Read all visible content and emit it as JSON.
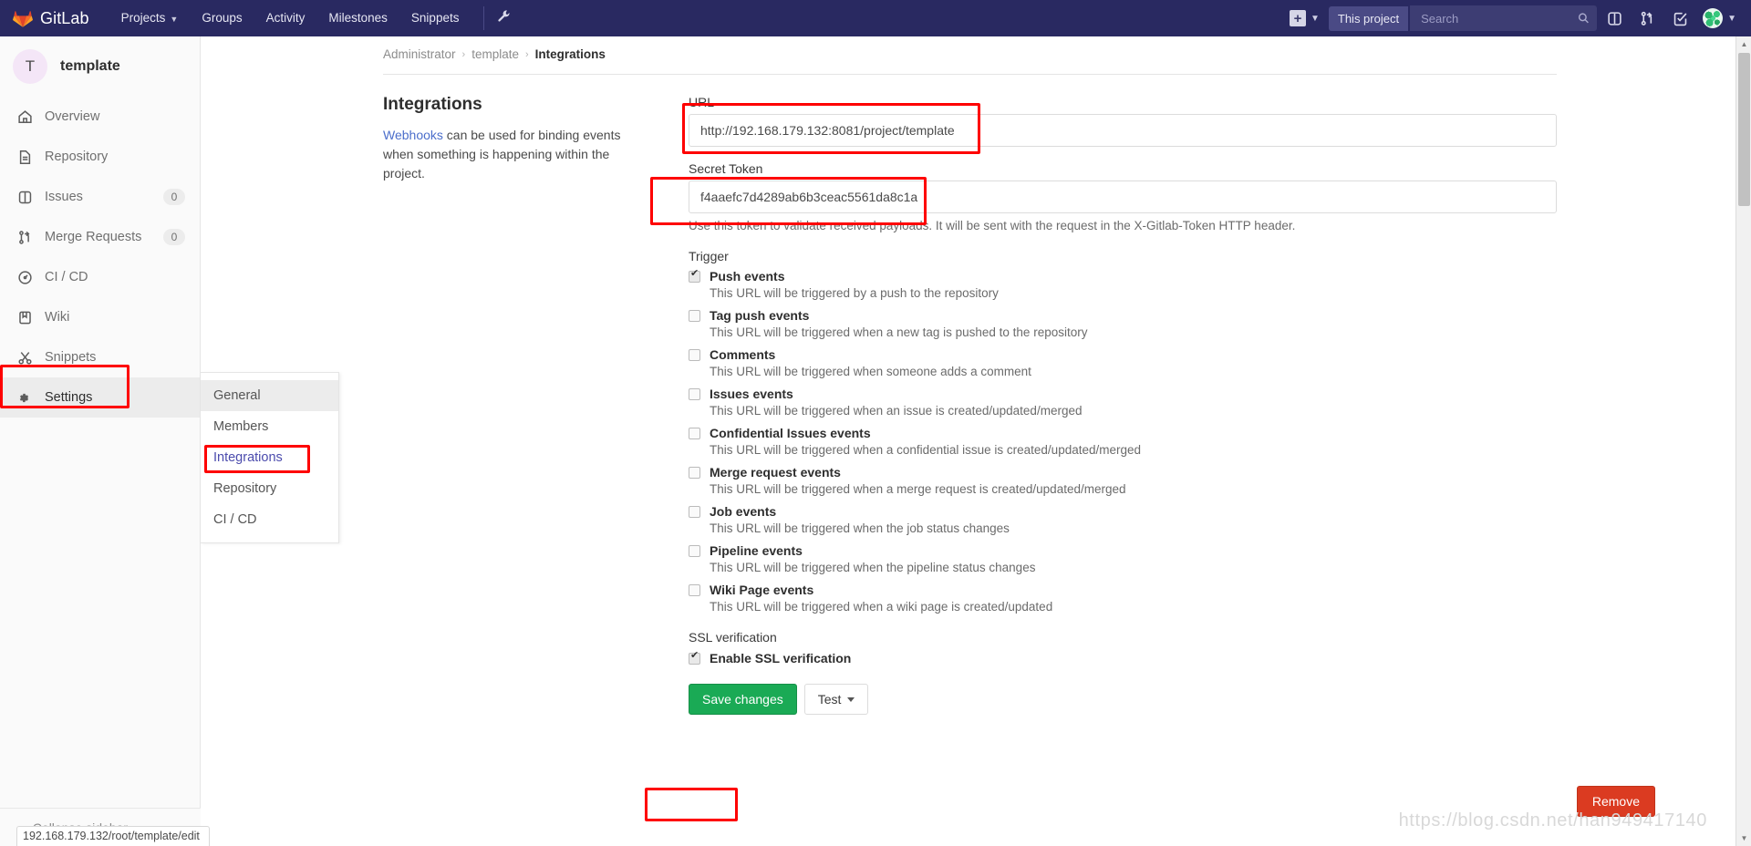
{
  "navbar": {
    "brand": "GitLab",
    "links": [
      {
        "label": "Projects",
        "has_caret": true
      },
      {
        "label": "Groups",
        "has_caret": false
      },
      {
        "label": "Activity",
        "has_caret": false
      },
      {
        "label": "Milestones",
        "has_caret": false
      },
      {
        "label": "Snippets",
        "has_caret": false
      }
    ],
    "wrench_icon": "wrench-icon",
    "plus_icon": "plus-icon",
    "project_scope": "This project",
    "search_placeholder": "Search",
    "search_value": "",
    "icons": [
      "issues-icon",
      "merge-requests-icon",
      "todos-icon"
    ],
    "avatar": "user-avatar"
  },
  "sidebar": {
    "project_initial": "T",
    "project_name": "template",
    "items": [
      {
        "label": "Overview",
        "icon": "home-icon",
        "badge": ""
      },
      {
        "label": "Repository",
        "icon": "document-icon",
        "badge": ""
      },
      {
        "label": "Issues",
        "icon": "issues-icon",
        "badge": "0"
      },
      {
        "label": "Merge Requests",
        "icon": "merge-requests-icon",
        "badge": "0"
      },
      {
        "label": "CI / CD",
        "icon": "rocket-icon",
        "badge": ""
      },
      {
        "label": "Wiki",
        "icon": "book-icon",
        "badge": ""
      },
      {
        "label": "Snippets",
        "icon": "scissors-icon",
        "badge": ""
      },
      {
        "label": "Settings",
        "icon": "gear-icon",
        "badge": ""
      }
    ],
    "collapse_label": "Collapse sidebar",
    "collapse_icon": "double-chevron-left-icon"
  },
  "submenu": {
    "items": [
      {
        "label": "General"
      },
      {
        "label": "Members"
      },
      {
        "label": "Integrations"
      },
      {
        "label": "Repository"
      },
      {
        "label": "CI / CD"
      }
    ],
    "current": "Integrations"
  },
  "breadcrumb": {
    "items": [
      "Administrator",
      "template",
      "Integrations"
    ],
    "separator": "›"
  },
  "integrations": {
    "title": "Integrations",
    "desc_link": "Webhooks",
    "desc_rest": " can be used for binding events when something is happening within the project.",
    "url": {
      "label": "URL",
      "value": "http://192.168.179.132:8081/project/template"
    },
    "secret_token": {
      "label": "Secret Token",
      "value": "f4aaefc7d4289ab6b3ceac5561da8c1a",
      "help": "Use this token to validate received payloads. It will be sent with the request in the X-Gitlab-Token HTTP header."
    },
    "trigger_label": "Trigger",
    "triggers": [
      {
        "label": "Push events",
        "desc": "This URL will be triggered by a push to the repository",
        "checked": true
      },
      {
        "label": "Tag push events",
        "desc": "This URL will be triggered when a new tag is pushed to the repository",
        "checked": false
      },
      {
        "label": "Comments",
        "desc": "This URL will be triggered when someone adds a comment",
        "checked": false
      },
      {
        "label": "Issues events",
        "desc": "This URL will be triggered when an issue is created/updated/merged",
        "checked": false
      },
      {
        "label": "Confidential Issues events",
        "desc": "This URL will be triggered when a confidential issue is created/updated/merged",
        "checked": false
      },
      {
        "label": "Merge request events",
        "desc": "This URL will be triggered when a merge request is created/updated/merged",
        "checked": false
      },
      {
        "label": "Job events",
        "desc": "This URL will be triggered when the job status changes",
        "checked": false
      },
      {
        "label": "Pipeline events",
        "desc": "This URL will be triggered when the pipeline status changes",
        "checked": false
      },
      {
        "label": "Wiki Page events",
        "desc": "This URL will be triggered when a wiki page is created/updated",
        "checked": false
      }
    ],
    "ssl_section_label": "SSL verification",
    "ssl_checkbox_label": "Enable SSL verification",
    "ssl_checked": true,
    "save_label": "Save changes",
    "test_label": "Test",
    "remove_label": "Remove"
  },
  "status_bar": {
    "text": "192.168.179.132/root/template/edit"
  },
  "watermark": {
    "text": "https://blog.csdn.net/han949417140"
  },
  "colors": {
    "nav_bg": "#292961",
    "accent_green": "#1aaa55",
    "accent_red": "#db3b21",
    "annotation_red": "#fe0000",
    "link_blue": "#4b6ecb"
  }
}
